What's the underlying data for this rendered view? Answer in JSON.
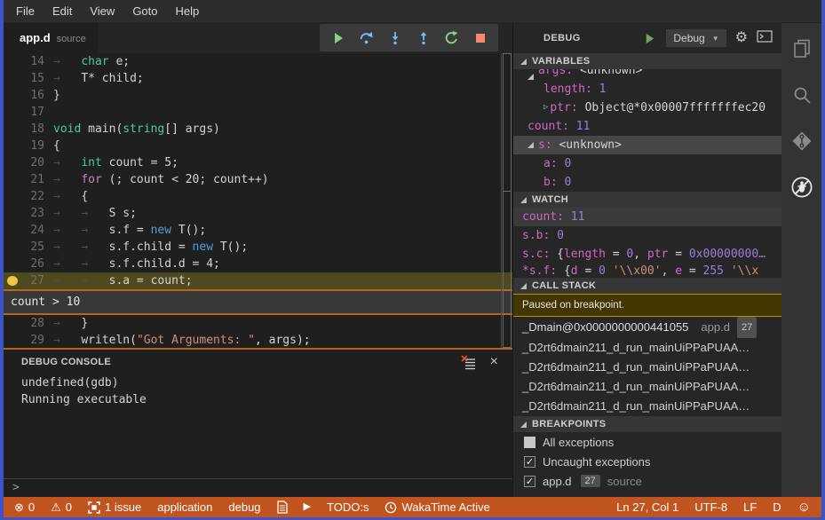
{
  "menu": {
    "items": [
      "File",
      "Edit",
      "View",
      "Goto",
      "Help"
    ]
  },
  "editor_tab": {
    "title": "app.d",
    "subtitle": "source"
  },
  "debug_toolbar": {
    "buttons": [
      {
        "name": "continue",
        "color": "#89D185"
      },
      {
        "name": "step-over",
        "color": "#75BEFF"
      },
      {
        "name": "step-into",
        "color": "#75BEFF"
      },
      {
        "name": "step-out",
        "color": "#75BEFF"
      },
      {
        "name": "restart",
        "color": "#89D185"
      },
      {
        "name": "stop",
        "color": "#F48771"
      }
    ]
  },
  "editor": {
    "lines": [
      {
        "num": "14",
        "tokens": [
          [
            "ws",
            "→   "
          ],
          [
            "k",
            "char"
          ],
          [
            "d",
            " e;"
          ]
        ]
      },
      {
        "num": "15",
        "tokens": [
          [
            "ws",
            "→   "
          ],
          [
            "d",
            "T* child;"
          ]
        ]
      },
      {
        "num": "16",
        "tokens": [
          [
            "d",
            "}"
          ]
        ]
      },
      {
        "num": "17",
        "tokens": []
      },
      {
        "num": "18",
        "tokens": [
          [
            "k",
            "void"
          ],
          [
            "d",
            " main("
          ],
          [
            "k",
            "string"
          ],
          [
            "d",
            "[] args)"
          ]
        ]
      },
      {
        "num": "19",
        "tokens": [
          [
            "d",
            "{"
          ]
        ]
      },
      {
        "num": "20",
        "tokens": [
          [
            "ws",
            "→   "
          ],
          [
            "k",
            "int"
          ],
          [
            "d",
            " count = 5;"
          ]
        ]
      },
      {
        "num": "21",
        "tokens": [
          [
            "ws",
            "→   "
          ],
          [
            "p",
            "for"
          ],
          [
            "d",
            " (; count < 20; count++)"
          ]
        ]
      },
      {
        "num": "22",
        "tokens": [
          [
            "ws",
            "→   "
          ],
          [
            "d",
            "{"
          ]
        ]
      },
      {
        "num": "23",
        "tokens": [
          [
            "ws",
            "→   →   "
          ],
          [
            "d",
            "S s;"
          ]
        ]
      },
      {
        "num": "24",
        "tokens": [
          [
            "ws",
            "→   →   "
          ],
          [
            "d",
            "s.f = "
          ],
          [
            "b",
            "new"
          ],
          [
            "d",
            " T();"
          ]
        ]
      },
      {
        "num": "25",
        "tokens": [
          [
            "ws",
            "→   →   "
          ],
          [
            "d",
            "s.f.child = "
          ],
          [
            "b",
            "new"
          ],
          [
            "d",
            " T();"
          ]
        ]
      },
      {
        "num": "26",
        "tokens": [
          [
            "ws",
            "→   →   "
          ],
          [
            "d",
            "s.f.child.d = 4;"
          ]
        ]
      },
      {
        "num": "27",
        "tokens": [
          [
            "ws",
            "→   →   "
          ],
          [
            "d",
            "s.a = count;"
          ]
        ],
        "current": true,
        "breakpoint": true
      },
      {
        "num": "28",
        "tokens": [
          [
            "ws",
            "→   "
          ],
          [
            "d",
            "}"
          ]
        ]
      },
      {
        "num": "29",
        "tokens": [
          [
            "ws",
            "→   "
          ],
          [
            "d",
            "writeln("
          ],
          [
            "s",
            "\"Got Arguments: \""
          ],
          [
            "d",
            ", args);"
          ]
        ]
      }
    ],
    "condition_widget": {
      "after_num": "27",
      "text": "count > 10"
    }
  },
  "debug_console": {
    "title": "DEBUG CONSOLE",
    "lines": [
      "undefined(gdb)",
      "Running executable"
    ],
    "prompt": ">"
  },
  "side_panel": {
    "header": {
      "title": "DEBUG",
      "dropdown_label": "Debug"
    },
    "variables": {
      "title": "VARIABLES",
      "rows": [
        {
          "indent": 1,
          "expander": "open",
          "clipped": true,
          "tokens": [
            [
              "name",
              "args: "
            ],
            [
              "d",
              "<unknown>"
            ]
          ]
        },
        {
          "indent": 2,
          "tokens": [
            [
              "name",
              "length: "
            ],
            [
              "num",
              "1"
            ]
          ]
        },
        {
          "indent": 2,
          "expander": "closed",
          "tokens": [
            [
              "name",
              "ptr: "
            ],
            [
              "d",
              "Object@*0x00007fffffffec20"
            ]
          ]
        },
        {
          "indent": 1,
          "tokens": [
            [
              "name",
              "count: "
            ],
            [
              "num",
              "11"
            ]
          ]
        },
        {
          "indent": 1,
          "expander": "open",
          "selected": true,
          "tokens": [
            [
              "name",
              "s: "
            ],
            [
              "d",
              "<unknown>"
            ]
          ]
        },
        {
          "indent": 2,
          "tokens": [
            [
              "name",
              "a: "
            ],
            [
              "num",
              "0"
            ]
          ]
        },
        {
          "indent": 2,
          "tokens": [
            [
              "name",
              "b: "
            ],
            [
              "num",
              "0"
            ]
          ]
        }
      ]
    },
    "watch": {
      "title": "WATCH",
      "rows": [
        {
          "selected": true,
          "tokens": [
            [
              "name",
              "count: "
            ],
            [
              "num",
              "11"
            ]
          ]
        },
        {
          "tokens": [
            [
              "name",
              "s.b: "
            ],
            [
              "num",
              "0"
            ]
          ]
        },
        {
          "tokens": [
            [
              "name",
              "s.c: "
            ],
            [
              "d",
              "{"
            ],
            [
              "name",
              "length"
            ],
            [
              "d",
              " = "
            ],
            [
              "num",
              "0"
            ],
            [
              "d",
              ", "
            ],
            [
              "name",
              "ptr"
            ],
            [
              "d",
              " = "
            ],
            [
              "num",
              "0x00000000…"
            ]
          ]
        },
        {
          "clipped": true,
          "tokens": [
            [
              "name",
              "*s.f: "
            ],
            [
              "d",
              "{"
            ],
            [
              "name",
              "d"
            ],
            [
              "d",
              " = "
            ],
            [
              "num",
              "0"
            ],
            [
              "d",
              " "
            ],
            [
              "str",
              "'\\\\x00'"
            ],
            [
              "d",
              ", "
            ],
            [
              "name",
              "e"
            ],
            [
              "d",
              " = "
            ],
            [
              "num",
              "255"
            ],
            [
              "d",
              " "
            ],
            [
              "str",
              "'\\\\x"
            ]
          ]
        }
      ]
    },
    "call_stack": {
      "title": "CALL STACK",
      "status": "Paused on breakpoint.",
      "frames": [
        {
          "label": "_Dmain@0x0000000000441055",
          "file": "app.d",
          "badge": "27"
        },
        {
          "label": "_D2rt6dmain211_d_run_mainUiPPaPUAA…"
        },
        {
          "label": "_D2rt6dmain211_d_run_mainUiPPaPUAA…"
        },
        {
          "label": "_D2rt6dmain211_d_run_mainUiPPaPUAA…"
        },
        {
          "label": "_D2rt6dmain211_d_run_mainUiPPaPUAA…"
        }
      ]
    },
    "breakpoints": {
      "title": "BREAKPOINTS",
      "items": [
        {
          "checked": false,
          "label": "All exceptions"
        },
        {
          "checked": true,
          "label": "Uncaught exceptions"
        },
        {
          "checked": true,
          "label": "app.d",
          "badge": "27",
          "sub": "source"
        }
      ]
    }
  },
  "activity_bar": {
    "icons": [
      {
        "name": "files",
        "active": false
      },
      {
        "name": "search",
        "active": false
      },
      {
        "name": "source-control",
        "active": false
      },
      {
        "name": "debug",
        "active": true
      }
    ]
  },
  "status_bar": {
    "background": "#C1541F",
    "left": [
      {
        "icon": "error-circle",
        "label": "0"
      },
      {
        "icon": "warning",
        "label": "0"
      },
      {
        "icon": "frame",
        "label": "1 issue"
      },
      {
        "label": "application"
      },
      {
        "label": "debug"
      },
      {
        "icon": "file"
      },
      {
        "icon": "play"
      },
      {
        "label": "TODO:s"
      },
      {
        "icon": "clock",
        "label": "WakaTime Active"
      }
    ],
    "right": [
      {
        "label": "Ln 27, Col 1"
      },
      {
        "label": "UTF-8"
      },
      {
        "label": "LF"
      },
      {
        "label": "D"
      },
      {
        "icon": "smiley"
      }
    ]
  },
  "colors": {
    "window_border": "#3D53C6",
    "statusbar": "#C1541F",
    "current_line": "#4d4a1f",
    "breakpoint_dot": "#EEC643",
    "accent_orange": "#B5651D",
    "keyword": "#4EC9A2",
    "keyword_control": "#C586C0",
    "keyword_new": "#569CD6",
    "string": "#CE9178",
    "var_name": "#CF68C2",
    "var_number": "#9B7FD4"
  }
}
